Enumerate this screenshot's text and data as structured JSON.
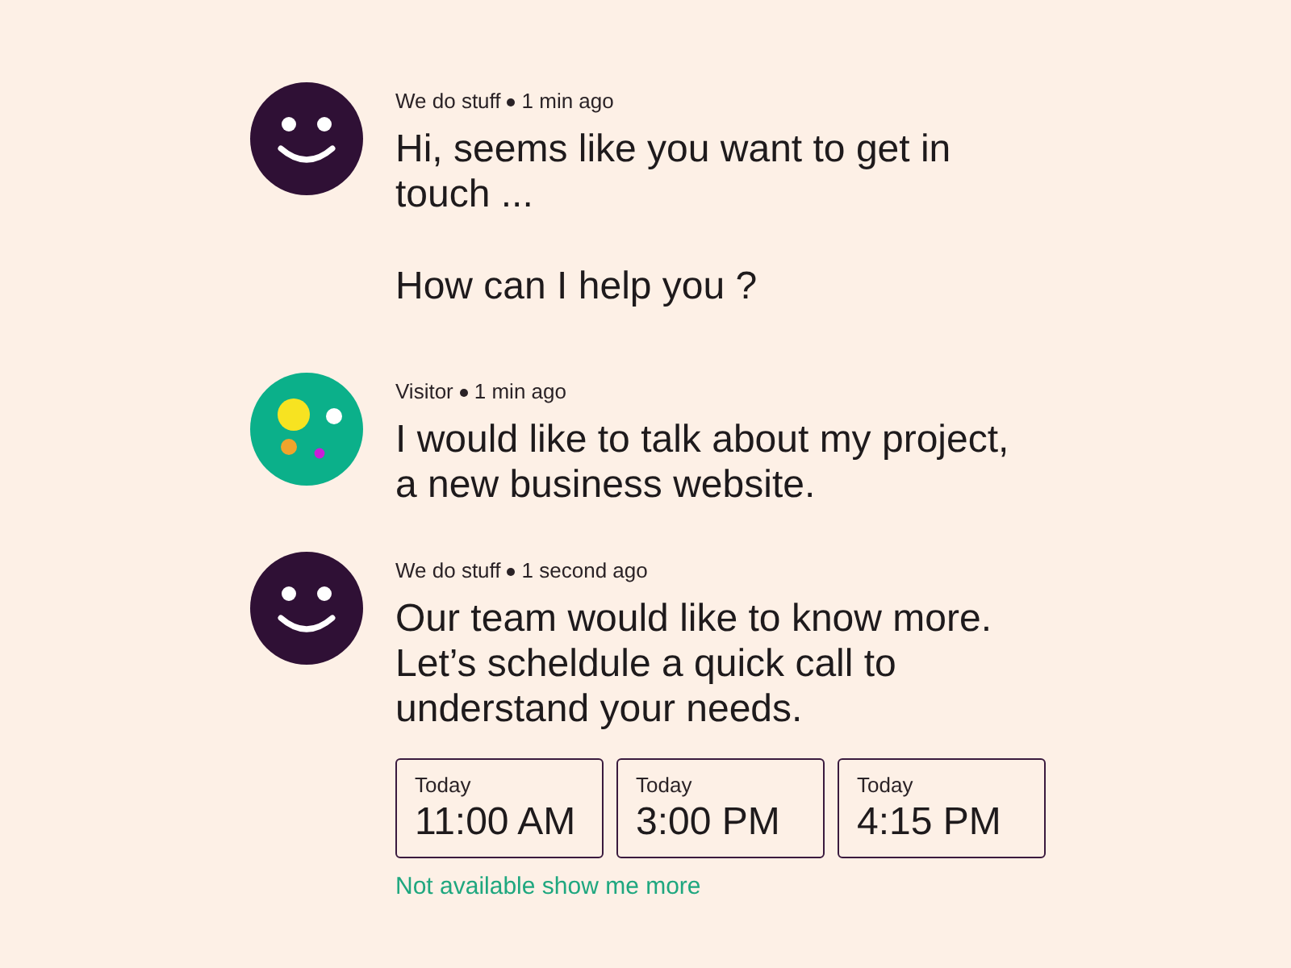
{
  "messages": [
    {
      "avatar": {
        "kind": "smiley"
      },
      "author": "We do stuff",
      "time": "1 min ago",
      "paragraphs": [
        "Hi, seems like you want to get in touch ...",
        "How can I help you ?"
      ]
    },
    {
      "avatar": {
        "kind": "dots"
      },
      "author": "Visitor",
      "time": "1 min ago",
      "paragraphs": [
        "I would like to talk about my project, a new business website."
      ]
    },
    {
      "avatar": {
        "kind": "smiley"
      },
      "author": "We do stuff",
      "time": "1 second ago",
      "paragraphs": [
        "Our team would like to know more. Let’s scheldule a quick call to understand your needs."
      ],
      "slots": [
        {
          "day": "Today",
          "time": "11:00 AM"
        },
        {
          "day": "Today",
          "time": "3:00 PM"
        },
        {
          "day": "Today",
          "time": "4:15 PM"
        }
      ],
      "link": "Not available show me more"
    }
  ]
}
